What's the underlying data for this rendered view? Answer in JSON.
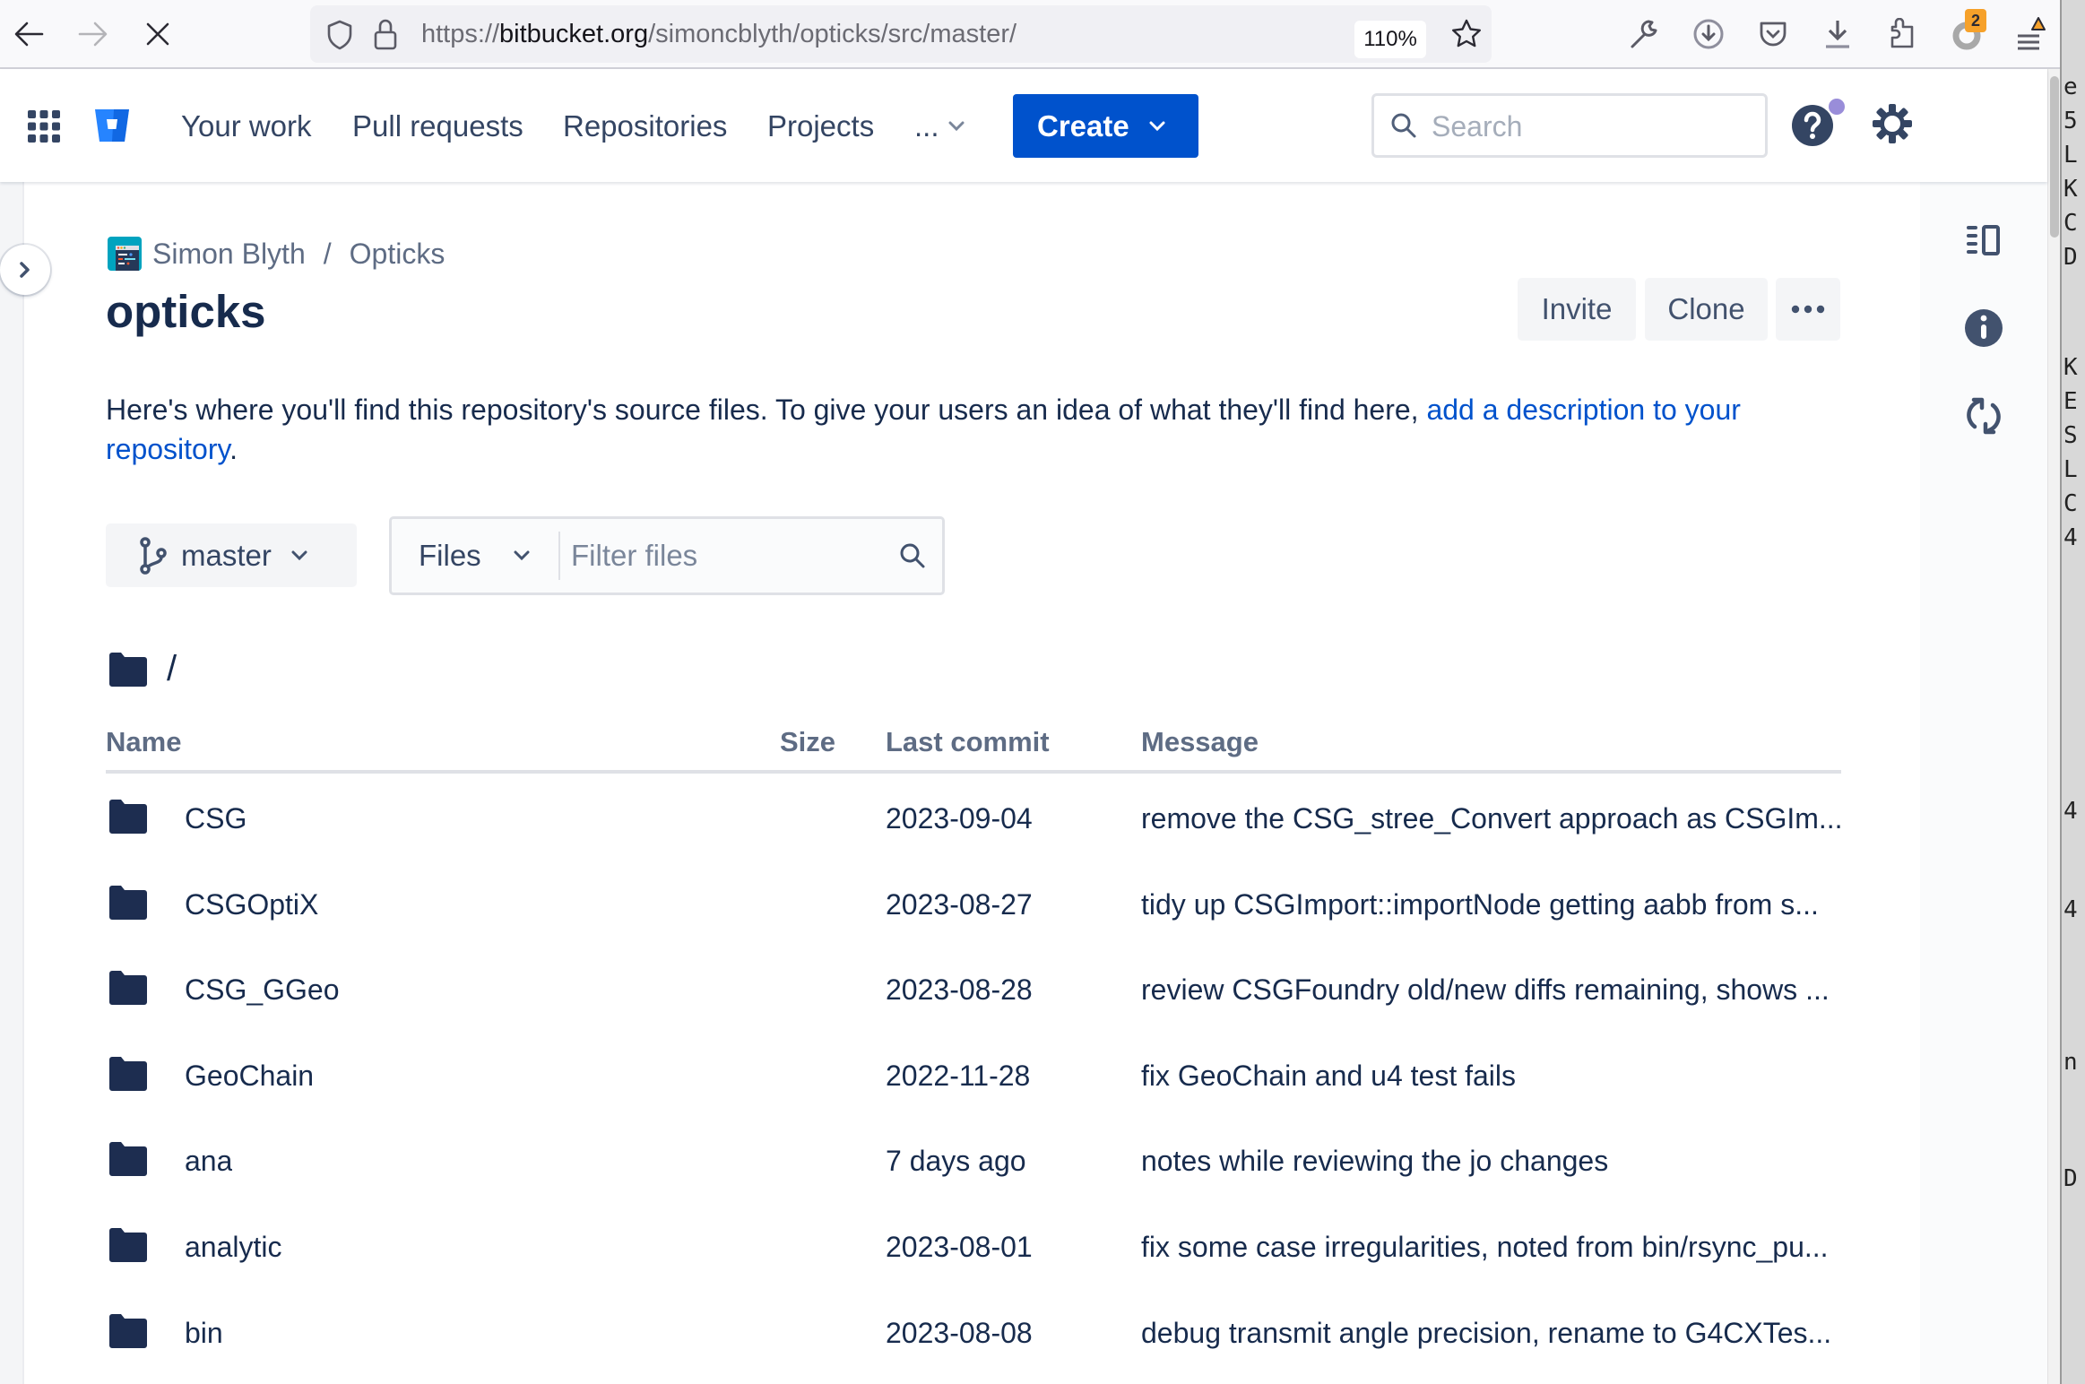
{
  "browser": {
    "url_scheme": "https://",
    "url_host": "bitbucket.org",
    "url_path": "/simoncblyth/opticks/src/master/",
    "zoom": "110%",
    "extension_badge": "2"
  },
  "nav": {
    "items": [
      "Your work",
      "Pull requests",
      "Repositories",
      "Projects"
    ],
    "more_label": "...",
    "create_label": "Create",
    "search_placeholder": "Search"
  },
  "breadcrumb": {
    "workspace": "Simon Blyth",
    "separator": "/",
    "project": "Opticks"
  },
  "page": {
    "title": "opticks",
    "invite_label": "Invite",
    "clone_label": "Clone",
    "more_label": "•••",
    "description_text": "Here's where you'll find this repository's source files. To give your users an idea of what they'll find here, ",
    "description_link": "add a description to your repository",
    "description_end": "."
  },
  "controls": {
    "branch": "master",
    "files_select": "Files",
    "filter_placeholder": "Filter files"
  },
  "path": "/",
  "table": {
    "headers": {
      "name": "Name",
      "size": "Size",
      "last_commit": "Last commit",
      "message": "Message"
    },
    "rows": [
      {
        "name": "CSG",
        "size": "",
        "last_commit": "2023-09-04",
        "message": "remove the CSG_stree_Convert approach as CSGIm..."
      },
      {
        "name": "CSGOptiX",
        "size": "",
        "last_commit": "2023-08-27",
        "message": "tidy up CSGImport::importNode getting aabb from s..."
      },
      {
        "name": "CSG_GGeo",
        "size": "",
        "last_commit": "2023-08-28",
        "message": "review CSGFoundry old/new diffs remaining, shows ..."
      },
      {
        "name": "GeoChain",
        "size": "",
        "last_commit": "2022-11-28",
        "message": "fix GeoChain and u4 test fails"
      },
      {
        "name": "ana",
        "size": "",
        "last_commit": "7 days ago",
        "message": "notes while reviewing the jo changes"
      },
      {
        "name": "analytic",
        "size": "",
        "last_commit": "2023-08-01",
        "message": "fix some case irregularities, noted from bin/rsync_pu..."
      },
      {
        "name": "bin",
        "size": "",
        "last_commit": "2023-08-08",
        "message": "debug transmit angle precision, rename to G4CXTes..."
      }
    ]
  },
  "background_window": {
    "fragments": [
      "e",
      "5",
      "L",
      "K",
      "C",
      "D",
      "K",
      "E",
      "S",
      "L",
      "C",
      "4",
      "4",
      "4",
      "n",
      "D"
    ]
  },
  "colors": {
    "brand_blue": "#0052cc",
    "text_primary": "#172b4d",
    "text_subtle": "#5e6c84",
    "link": "#0052cc",
    "notification_dot": "#998dd9",
    "extension_badge": "#f6a12a"
  }
}
